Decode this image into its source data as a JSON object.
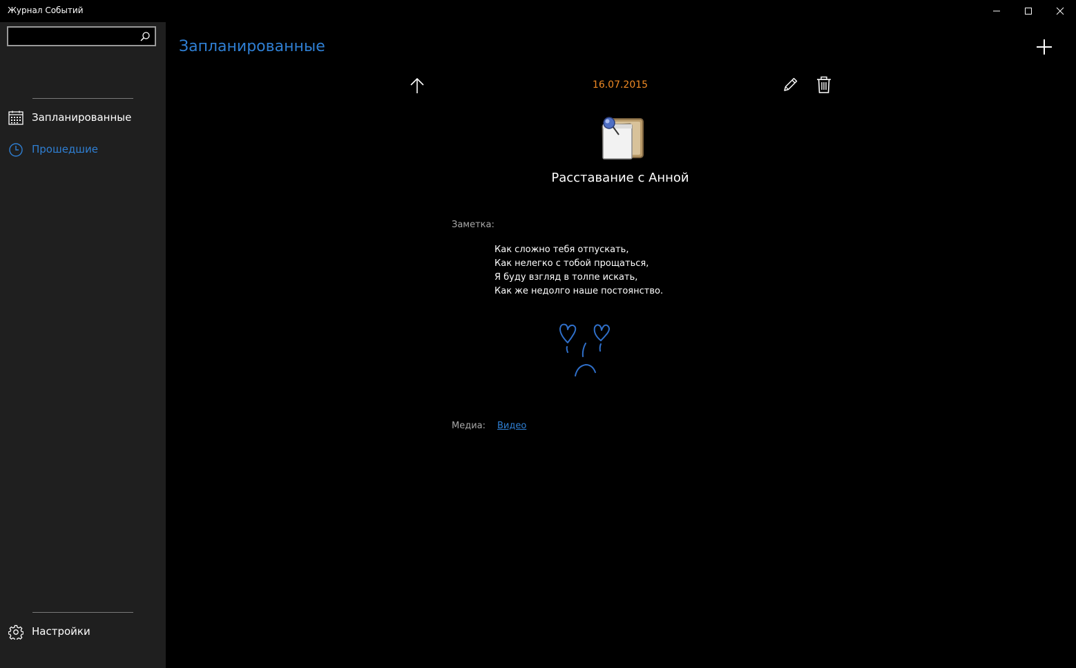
{
  "window": {
    "title": "Журнал Событий",
    "controls": [
      "minimize-icon",
      "maximize-icon",
      "close-icon"
    ]
  },
  "sidebar": {
    "search": {
      "value": "",
      "placeholder": "",
      "icon": "search-icon"
    },
    "items": [
      {
        "label": "Запланированные",
        "icon": "calendar-icon",
        "selected": false
      },
      {
        "label": "Прошедшие",
        "icon": "clock-icon",
        "selected": true
      }
    ],
    "footer": {
      "label": "Настройки",
      "icon": "gear-icon"
    }
  },
  "header": {
    "title": "Запланированные",
    "add_icon": "plus-icon"
  },
  "event": {
    "date": "16.07.2015",
    "title": "Расставание с Анной",
    "note_label": "Заметка:",
    "note_lines": [
      "Как сложно тебя отпускать,",
      "Как нелегко с тобой прощаться,",
      "Я буду взгляд в толпе искать,",
      "Как же недолго наше постоянство."
    ],
    "media_label": "Медиа:",
    "media_link": "Видео"
  },
  "colors": {
    "accent": "#2f7fd3",
    "date": "#f08a24",
    "sidebar_bg": "#1f1f1f",
    "background": "#000000"
  }
}
